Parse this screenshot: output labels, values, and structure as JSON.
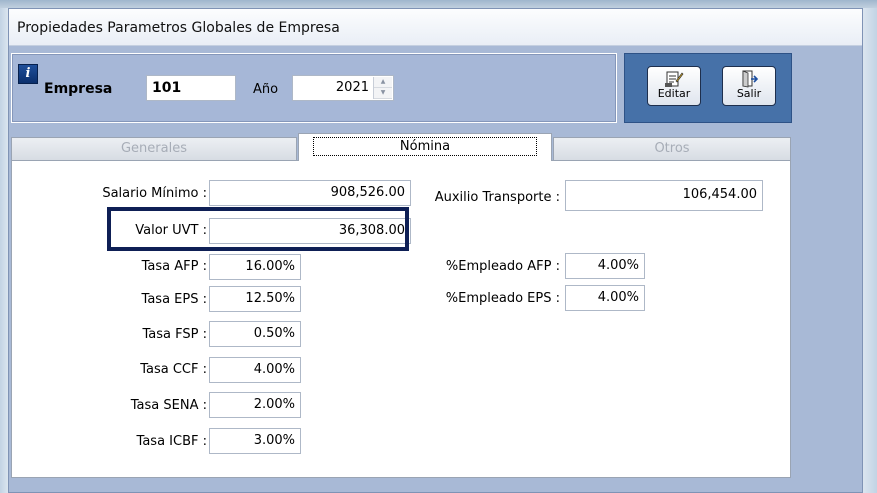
{
  "window": {
    "title": "Propiedades Parametros Globales de Empresa"
  },
  "header": {
    "empresa_label": "Empresa",
    "empresa_value": "101",
    "ano_label": "Año",
    "ano_value": "2021"
  },
  "toolbar": {
    "editar_label": "Editar",
    "salir_label": "Salir"
  },
  "tabs": [
    {
      "label": "Generales",
      "active": false
    },
    {
      "label": "Nómina",
      "active": true
    },
    {
      "label": "Otros",
      "active": false
    }
  ],
  "nomina": {
    "salario_minimo": {
      "label": "Salario Mínimo :",
      "value": "908,526.00"
    },
    "valor_uvt": {
      "label": "Valor UVT :",
      "value": "36,308.00"
    },
    "auxilio_transporte": {
      "label": "Auxilio Transporte :",
      "value": "106,454.00"
    },
    "tasa_afp": {
      "label": "Tasa AFP :",
      "value": "16.00%"
    },
    "tasa_eps": {
      "label": "Tasa EPS :",
      "value": "12.50%"
    },
    "tasa_fsp": {
      "label": "Tasa FSP :",
      "value": "0.50%"
    },
    "tasa_ccf": {
      "label": "Tasa CCF :",
      "value": "4.00%"
    },
    "tasa_sena": {
      "label": "Tasa SENA :",
      "value": "2.00%"
    },
    "tasa_icbf": {
      "label": "Tasa ICBF :",
      "value": "3.00%"
    },
    "empleado_afp": {
      "label": "%Empleado AFP :",
      "value": "4.00%"
    },
    "empleado_eps": {
      "label": "%Empleado EPS :",
      "value": "4.00%"
    }
  },
  "colors": {
    "highlight_border": "#0e1f55",
    "button_panel": "#4671a8",
    "dialog_bg": "#a8b9d6"
  }
}
